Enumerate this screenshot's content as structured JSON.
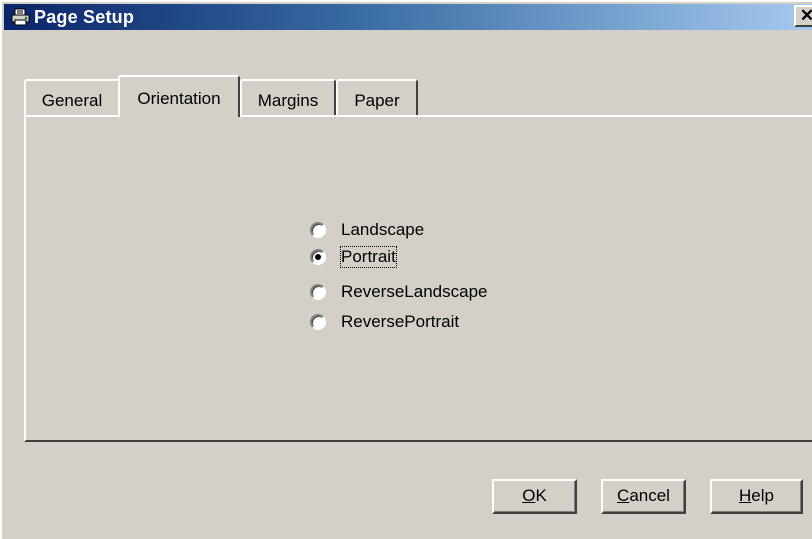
{
  "window": {
    "title": "Page Setup",
    "close_glyph": "✕",
    "icon": "printer-icon"
  },
  "tabs": [
    {
      "label": "General",
      "active": false
    },
    {
      "label": "Orientation",
      "active": true
    },
    {
      "label": "Margins",
      "active": false
    },
    {
      "label": "Paper",
      "active": false
    }
  ],
  "orientation": {
    "options": [
      {
        "label": "Landscape",
        "selected": false
      },
      {
        "label": "Portrait",
        "selected": true
      },
      {
        "label": "ReverseLandscape",
        "selected": false
      },
      {
        "label": "ReversePortrait",
        "selected": false
      }
    ]
  },
  "buttons": {
    "ok": {
      "mnemonic": "O",
      "rest": "K"
    },
    "cancel": {
      "mnemonic": "C",
      "rest": "ancel"
    },
    "help": {
      "mnemonic": "H",
      "rest": "elp"
    }
  },
  "colors": {
    "face": "#d4d0c8",
    "title_start": "#0a246a",
    "title_end": "#a6caf0"
  }
}
